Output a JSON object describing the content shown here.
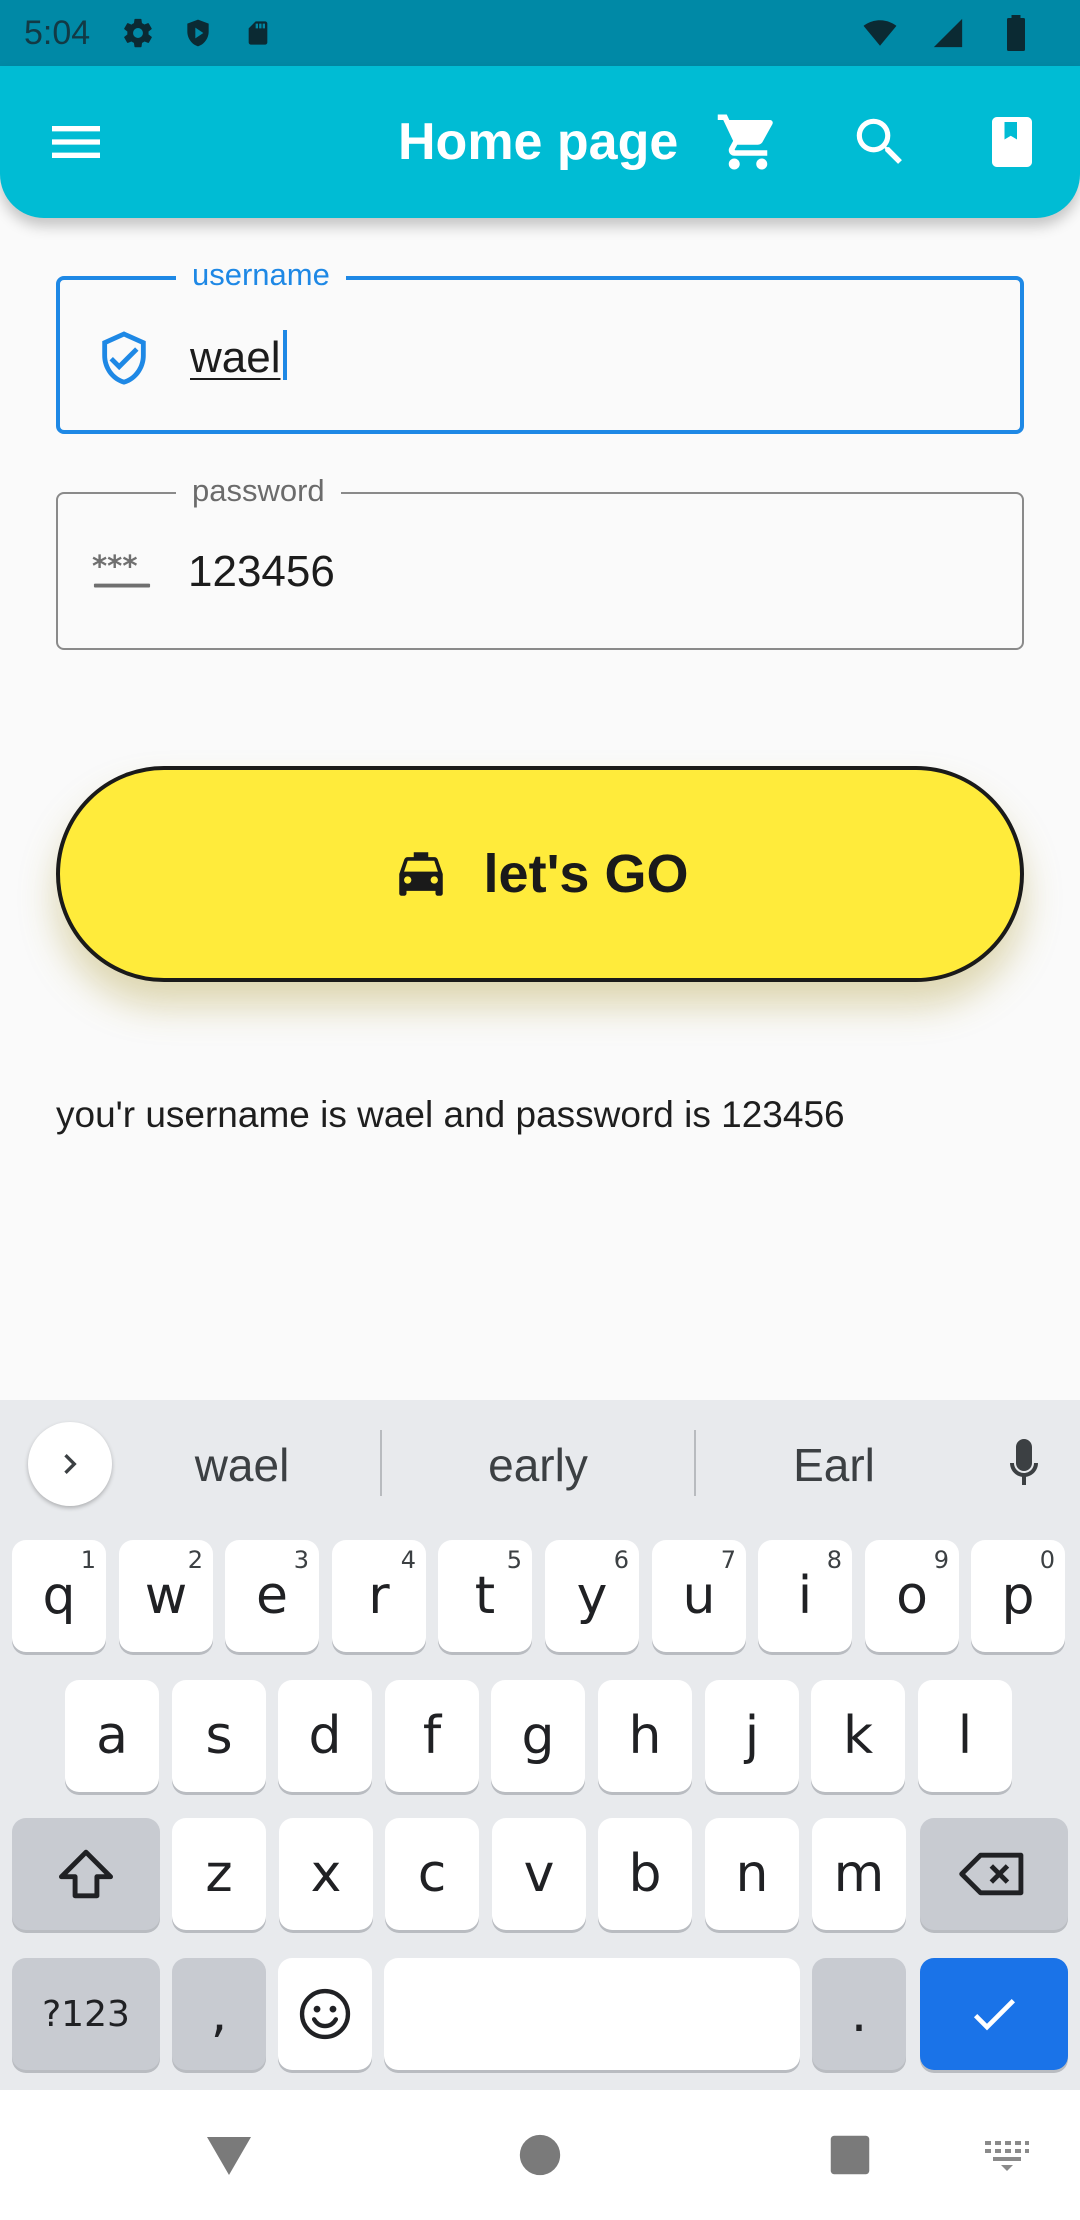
{
  "status_bar": {
    "time": "5:04",
    "icons_left": [
      "gear-icon",
      "shield-play-icon",
      "sd-card-icon"
    ],
    "icons_right": [
      "wifi-icon",
      "signal-icon",
      "battery-icon"
    ]
  },
  "app_bar": {
    "title": "Home page",
    "icons": [
      "menu-icon",
      "cart-icon",
      "search-icon",
      "book-icon"
    ],
    "color": "#00bcd4"
  },
  "form": {
    "username": {
      "label": "username",
      "value": "wael",
      "icon": "verified-shield-icon"
    },
    "password": {
      "label": "password",
      "value": "123456",
      "icon": "password-icon"
    }
  },
  "go_button": {
    "label": "let's GO",
    "icon": "taxi-icon",
    "color": "#ffeb3b"
  },
  "result": "you'r username is wael and password is 123456",
  "keyboard": {
    "suggestions": [
      "wael",
      "early",
      "Earl"
    ],
    "row1": [
      {
        "key": "q",
        "hint": "1"
      },
      {
        "key": "w",
        "hint": "2"
      },
      {
        "key": "e",
        "hint": "3"
      },
      {
        "key": "r",
        "hint": "4"
      },
      {
        "key": "t",
        "hint": "5"
      },
      {
        "key": "y",
        "hint": "6"
      },
      {
        "key": "u",
        "hint": "7"
      },
      {
        "key": "i",
        "hint": "8"
      },
      {
        "key": "o",
        "hint": "9"
      },
      {
        "key": "p",
        "hint": "0"
      }
    ],
    "row2": [
      "a",
      "s",
      "d",
      "f",
      "g",
      "h",
      "j",
      "k",
      "l"
    ],
    "row3": [
      "z",
      "x",
      "c",
      "v",
      "b",
      "n",
      "m"
    ],
    "symbols_label": "?123",
    "comma": ",",
    "period": ".",
    "action_color": "#1a73e8"
  }
}
